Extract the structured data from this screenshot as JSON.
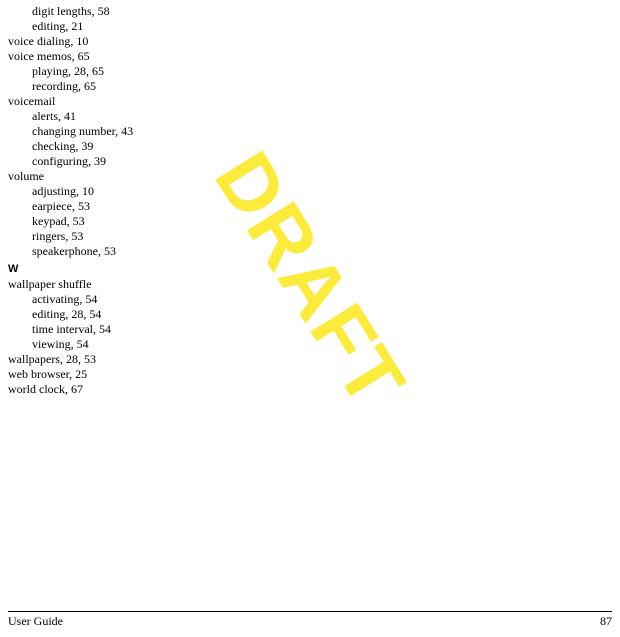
{
  "watermark": "DRAFT",
  "footer": {
    "left": "User Guide",
    "right": "87"
  },
  "index": {
    "pre": [
      {
        "level": 1,
        "label": "digit lengths, 58"
      },
      {
        "level": 1,
        "label": "editing, 21"
      },
      {
        "level": 0,
        "label": "voice dialing, 10"
      },
      {
        "level": 0,
        "label": "voice memos, 65"
      },
      {
        "level": 1,
        "label": "playing, 28, 65"
      },
      {
        "level": 1,
        "label": "recording, 65"
      },
      {
        "level": 0,
        "label": "voicemail"
      },
      {
        "level": 1,
        "label": "alerts, 41"
      },
      {
        "level": 1,
        "label": "changing number, 43"
      },
      {
        "level": 1,
        "label": "checking, 39"
      },
      {
        "level": 1,
        "label": "configuring, 39"
      },
      {
        "level": 0,
        "label": "volume"
      },
      {
        "level": 1,
        "label": "adjusting, 10"
      },
      {
        "level": 1,
        "label": "earpiece, 53"
      },
      {
        "level": 1,
        "label": "keypad, 53"
      },
      {
        "level": 1,
        "label": "ringers, 53"
      },
      {
        "level": 1,
        "label": "speakerphone, 53"
      }
    ],
    "section_w": "W",
    "w": [
      {
        "level": 0,
        "label": "wallpaper shuffle"
      },
      {
        "level": 1,
        "label": "activating, 54"
      },
      {
        "level": 1,
        "label": "editing, 28, 54"
      },
      {
        "level": 1,
        "label": "time interval, 54"
      },
      {
        "level": 1,
        "label": "viewing, 54"
      },
      {
        "level": 0,
        "label": "wallpapers, 28, 53"
      },
      {
        "level": 0,
        "label": "web browser, 25"
      },
      {
        "level": 0,
        "label": "world clock, 67"
      }
    ]
  }
}
